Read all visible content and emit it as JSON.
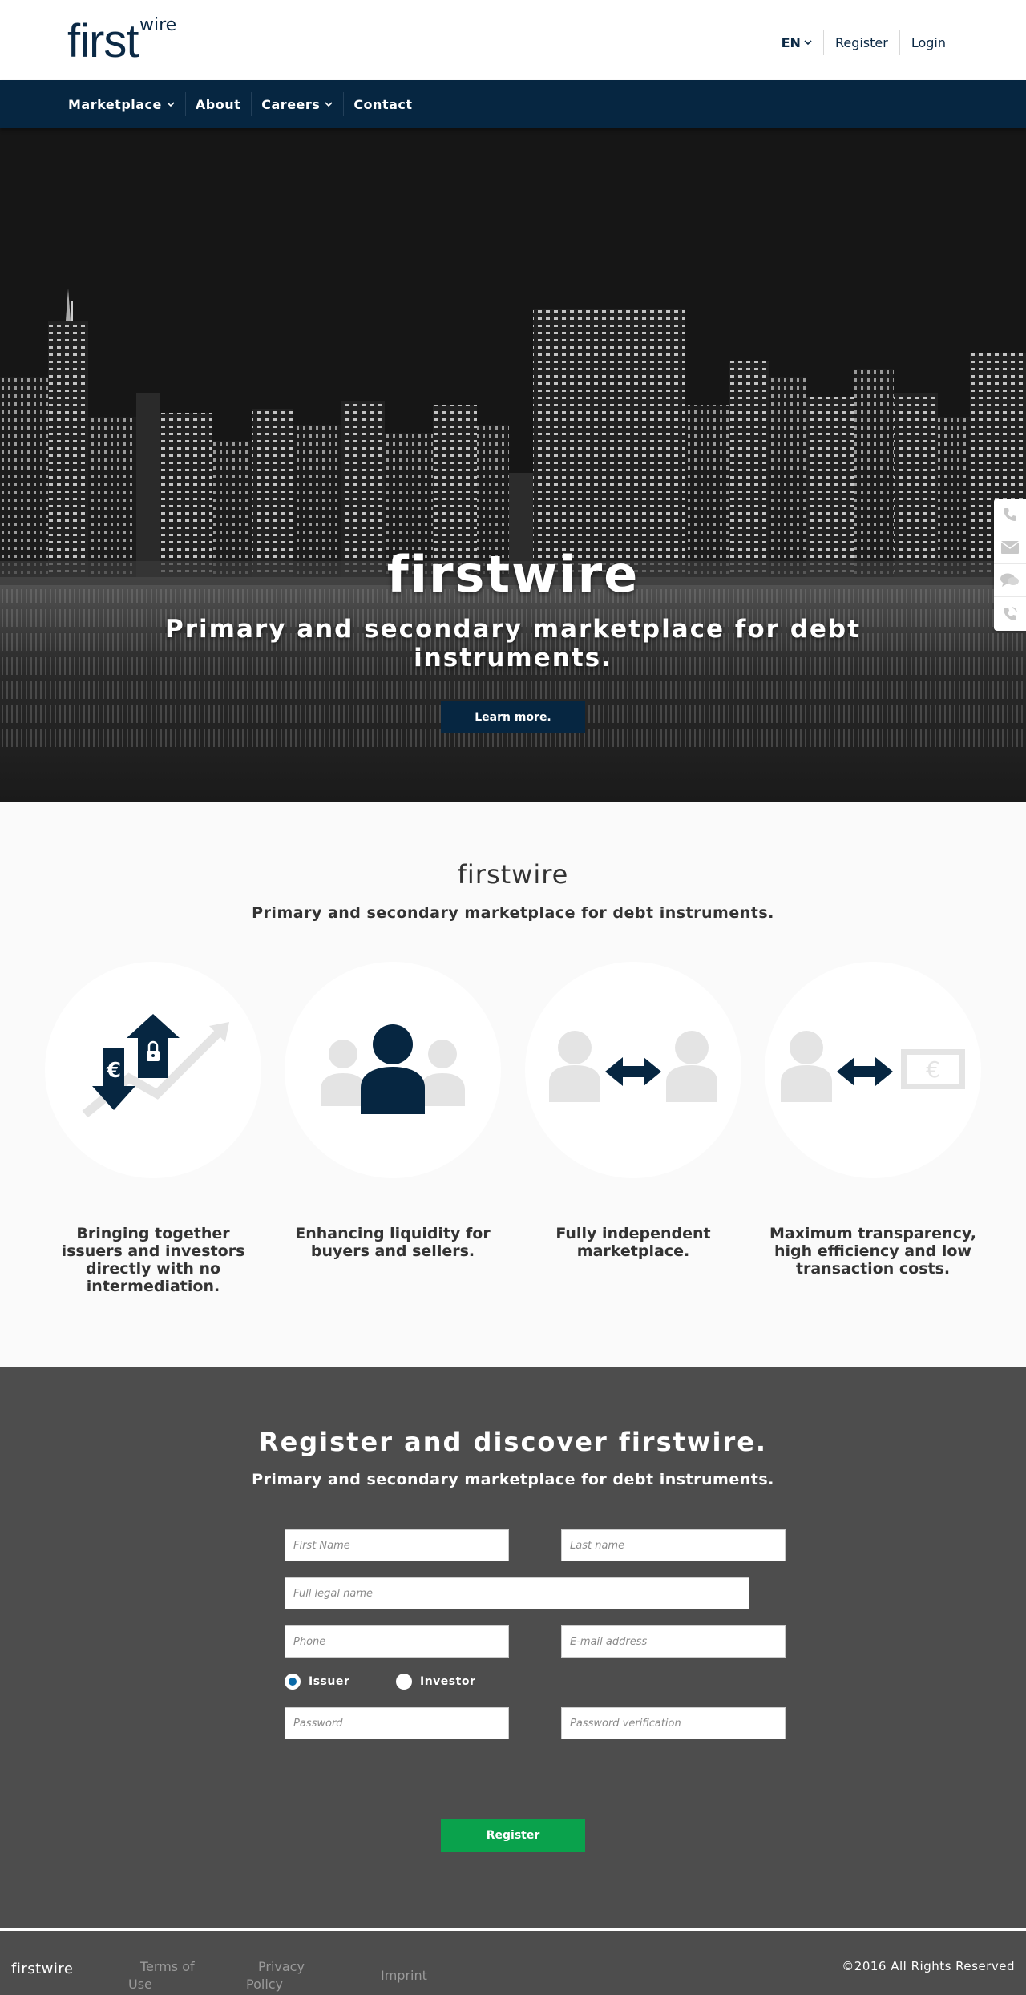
{
  "header": {
    "logo_first": "first",
    "logo_wire": "wire",
    "lang": "EN",
    "register": "Register",
    "login": "Login"
  },
  "nav": {
    "items": [
      {
        "label": "Marketplace"
      },
      {
        "label": "About"
      },
      {
        "label": "Careers"
      },
      {
        "label": "Contact"
      }
    ]
  },
  "hero": {
    "title": "firstwire",
    "subtitle": "Primary and secondary marketplace for debt instruments.",
    "button": "Learn more."
  },
  "side_widget": {
    "icons": [
      "phone-icon",
      "mail-icon",
      "chat-icon",
      "callback-icon"
    ]
  },
  "intro": {
    "title": "firstwire",
    "subtitle": "Primary and secondary marketplace for debt instruments."
  },
  "features": [
    {
      "icon": "exchange-arrows-icon",
      "text": "Bringing together issuers and investors directly with no intermediation."
    },
    {
      "icon": "users-group-icon",
      "text": "Enhancing liquidity for buyers and sellers."
    },
    {
      "icon": "peer-to-peer-icon",
      "text": "Fully independent marketplace."
    },
    {
      "icon": "user-money-exchange-icon",
      "text": "Maximum transparency, high efficiency and low transaction costs."
    }
  ],
  "register": {
    "title": "Register and discover firstwire.",
    "subtitle": "Primary and secondary marketplace for debt instruments.",
    "first_name_placeholder": "First Name",
    "last_name_placeholder": "Last name",
    "legal_name_placeholder": "Full legal name",
    "phone_placeholder": "Phone",
    "email_placeholder": "E-mail address",
    "radio_issuer": "Issuer",
    "radio_investor": "Investor",
    "selected_role": "Issuer",
    "password_placeholder": "Password",
    "password_verify_placeholder": "Password verification",
    "button": "Register"
  },
  "footer": {
    "logo": "firstwire",
    "terms": "Terms of Use",
    "privacy": "Privacy Policy",
    "imprint": "Imprint",
    "copyright": "©2016 All Rights Reserved"
  },
  "colors": {
    "navy": "#062641",
    "green": "#0aa24c",
    "dark_gray": "#4d4d4d",
    "light_bg": "#fafafa"
  }
}
